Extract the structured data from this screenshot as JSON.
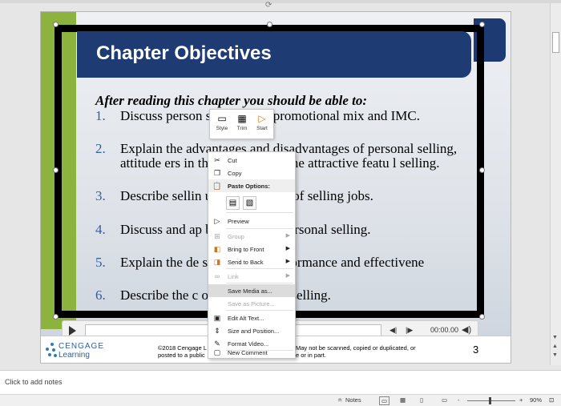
{
  "slide": {
    "title": "Chapter Objectives",
    "intro": "After reading this chapter you should be able to:",
    "objectives": [
      {
        "num": "1.",
        "text": "Discuss person        s role in the promotional mix and IMC."
      },
      {
        "num": "2.",
        "text": "Explain the advantages and disadvantages of personal selling, attitude            ers in this field, and some attractive featu            l selling."
      },
      {
        "num": "3.",
        "text": "Describe sellin              uties, and types of selling jobs."
      },
      {
        "num": "4.",
        "text": "Discuss and ap              basic steps in personal selling."
      },
      {
        "num": "5.",
        "text": "Explain the de              salesperson performance and effectivene"
      },
      {
        "num": "6.",
        "text": "Describe the c              of excellence in selling."
      }
    ],
    "footer": {
      "logo_top": "CENGAGE",
      "logo_bottom": "Learning",
      "copyright_line1": "©2018 Cengage L",
      "copyright_line2": "posted to a public",
      "copyright_right1": "May not be scanned, copied or duplicated, or",
      "copyright_right2": "e or in part.",
      "page_number": "3"
    },
    "colors": {
      "title_band": "#1f3b73",
      "green_bar": "#8db33f",
      "number": "#2e5f9e"
    }
  },
  "media": {
    "time": "00:00.00",
    "play_icon": "play-icon",
    "rewind_icon": "rewind-icon",
    "forward_icon": "forward-icon",
    "volume_icon": "volume-icon"
  },
  "mini_toolbar": {
    "style": "Style",
    "trim": "Trim",
    "start": "Start"
  },
  "context_menu": {
    "cut": "Cut",
    "copy": "Copy",
    "paste_options": "Paste Options:",
    "preview": "Preview",
    "group": "Group",
    "bring_to_front": "Bring to Front",
    "send_to_back": "Send to Back",
    "link": "Link",
    "save_media_as": "Save Media as...",
    "save_as_picture": "Save as Picture...",
    "edit_alt_text": "Edit Alt Text...",
    "size_and_position": "Size and Position...",
    "format_video": "Format Video...",
    "new_comment": "New Comment"
  },
  "notes": {
    "placeholder": "Click to add notes"
  },
  "status_bar": {
    "notes": "Notes",
    "zoom": "90%",
    "zoom_minus": "-",
    "zoom_plus": "+"
  }
}
